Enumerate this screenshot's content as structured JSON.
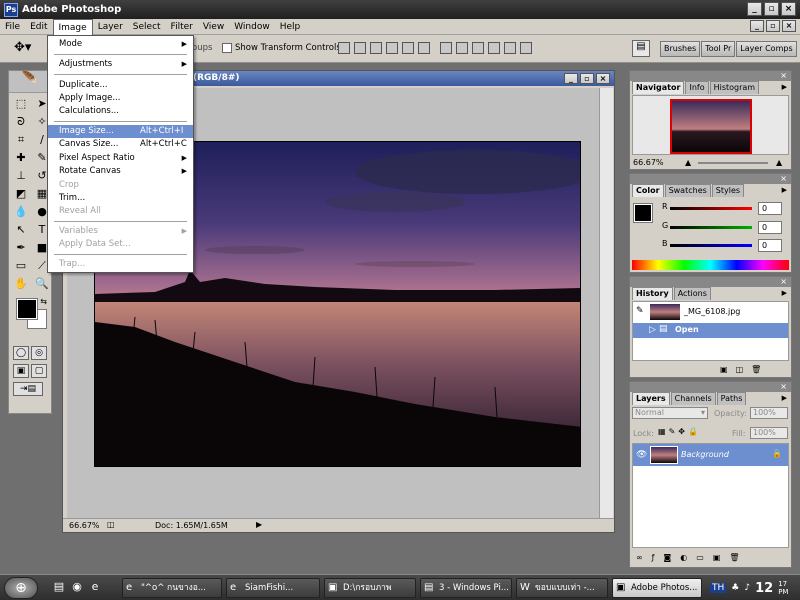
{
  "app": {
    "title": "Adobe Photoshop"
  },
  "menubar": [
    "File",
    "Edit",
    "Image",
    "Layer",
    "Select",
    "Filter",
    "View",
    "Window",
    "Help"
  ],
  "options": {
    "show_transform": "Show Transform Controls",
    "partial_label": "oups",
    "palette_well": [
      "Brushes",
      "Tool Pr",
      "Layer Comps"
    ]
  },
  "document": {
    "title": "(RGB/8#)",
    "zoom": "66.67%",
    "doc_size": "Doc: 1.65M/1.65M"
  },
  "image_menu": {
    "items": [
      {
        "label": "Mode",
        "submenu": true
      },
      {
        "label": "Adjustments",
        "submenu": true
      },
      {
        "label": "Duplicate..."
      },
      {
        "label": "Apply Image..."
      },
      {
        "label": "Calculations..."
      },
      {
        "label": "Image Size...",
        "shortcut": "Alt+Ctrl+I",
        "highlighted": true
      },
      {
        "label": "Canvas Size...",
        "shortcut": "Alt+Ctrl+C"
      },
      {
        "label": "Pixel Aspect Ratio",
        "submenu": true
      },
      {
        "label": "Rotate Canvas",
        "submenu": true
      },
      {
        "label": "Crop",
        "disabled": true
      },
      {
        "label": "Trim..."
      },
      {
        "label": "Reveal All",
        "disabled": true
      },
      {
        "label": "Variables",
        "submenu": true,
        "disabled": true
      },
      {
        "label": "Apply Data Set...",
        "disabled": true
      },
      {
        "label": "Trap...",
        "disabled": true
      }
    ]
  },
  "navigator": {
    "tabs": [
      "Navigator",
      "Info",
      "Histogram"
    ],
    "zoom": "66.67%"
  },
  "color": {
    "tabs": [
      "Color",
      "Swatches",
      "Styles"
    ],
    "channels": [
      {
        "label": "R",
        "value": "0",
        "color": "#ff0000"
      },
      {
        "label": "G",
        "value": "0",
        "color": "#00b000"
      },
      {
        "label": "B",
        "value": "0",
        "color": "#0000ff"
      }
    ]
  },
  "history": {
    "tabs": [
      "History",
      "Actions"
    ],
    "snapshot": "_MG_6108.jpg",
    "state": "Open"
  },
  "layers": {
    "tabs": [
      "Layers",
      "Channels",
      "Paths"
    ],
    "blend_mode": "Normal",
    "opacity_label": "Opacity:",
    "opacity": "100%",
    "lock_label": "Lock:",
    "fill_label": "Fill:",
    "fill": "100%",
    "layer_name": "Background"
  },
  "taskbar": {
    "tasks": [
      {
        "label": "\"^o^ กนขางอ...",
        "icon": "e"
      },
      {
        "label": "SiamFishi...",
        "icon": "e"
      },
      {
        "label": "D:\\กรอบภาพ",
        "icon": "▣"
      },
      {
        "label": "3 - Windows Pi...",
        "icon": "▤"
      },
      {
        "label": "ขอบแบบเท่า -...",
        "icon": "W"
      },
      {
        "label": "Adobe Photos...",
        "icon": "▣",
        "active": true
      }
    ],
    "tray_lang": "TH",
    "clock_hour": "12",
    "clock_min_top": "17",
    "clock_min_bot": "PM"
  },
  "colors": {
    "accent": "#6d8fcf",
    "title_blue": "#3a5a9c"
  }
}
